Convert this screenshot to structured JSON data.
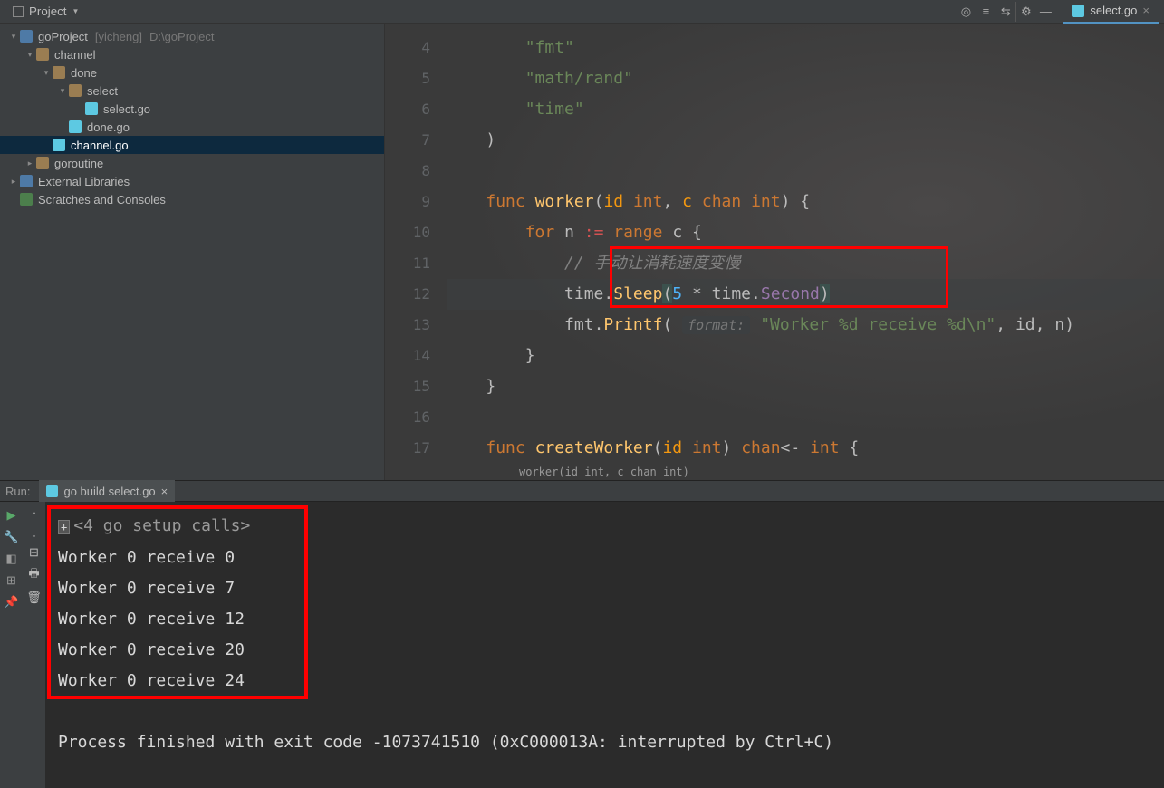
{
  "topbar": {
    "project_label": "Project",
    "toolbar_icons": [
      "target-icon",
      "collapse-icon",
      "settings-icon",
      "gear-icon",
      "minimize-icon"
    ]
  },
  "open_tab": {
    "name": "select.go"
  },
  "tree": [
    {
      "depth": 0,
      "arrow": "down",
      "icon": "module",
      "label": "goProject",
      "hint": "[yicheng]",
      "extra": "D:\\goProject",
      "interact": true
    },
    {
      "depth": 1,
      "arrow": "down",
      "icon": "folder",
      "label": "channel",
      "interact": true
    },
    {
      "depth": 2,
      "arrow": "down",
      "icon": "folder",
      "label": "done",
      "interact": true
    },
    {
      "depth": 3,
      "arrow": "down",
      "icon": "folder",
      "label": "select",
      "interact": true
    },
    {
      "depth": 4,
      "arrow": "none",
      "icon": "go",
      "label": "select.go",
      "interact": true
    },
    {
      "depth": 3,
      "arrow": "none",
      "icon": "go",
      "label": "done.go",
      "interact": true
    },
    {
      "depth": 2,
      "arrow": "none",
      "icon": "go",
      "label": "channel.go",
      "interact": true,
      "selected": true
    },
    {
      "depth": 1,
      "arrow": "right",
      "icon": "folder",
      "label": "goroutine",
      "interact": true
    },
    {
      "depth": 0,
      "arrow": "right",
      "icon": "module",
      "label": "External Libraries",
      "interact": true
    },
    {
      "depth": 0,
      "arrow": "none",
      "icon": "scratch",
      "label": "Scratches and Consoles",
      "interact": true
    }
  ],
  "editor": {
    "lines": [
      4,
      5,
      6,
      7,
      8,
      9,
      10,
      11,
      12,
      13,
      14,
      15,
      16,
      17
    ],
    "code": {
      "l4": "\"fmt\"",
      "l5": "\"math/rand\"",
      "l6": "\"time\"",
      "l9_func": "func",
      "l9_name": "worker",
      "l9_p1": "id",
      "l9_t1": "int",
      "l9_p2": "c",
      "l9_kw": "chan",
      "l9_t2": "int",
      "l10_for": "for",
      "l10_n": "n",
      "l10_assign": ":=",
      "l10_range": "range",
      "l10_c": "c",
      "l11_comment": "// 手动让消耗速度变慢",
      "l12_time": "time",
      "l12_sleep": "Sleep",
      "l12_5": "5",
      "l12_star": "*",
      "l12_time2": "time",
      "l12_sec": "Second",
      "l13_fmt": "fmt",
      "l13_printf": "Printf",
      "l13_hint": "format:",
      "l13_fmtstr": "\"Worker %d receive %d\\n\"",
      "l13_id": "id",
      "l13_n": "n",
      "l17_func": "func",
      "l17_name": "createWorker",
      "l17_p": "id",
      "l17_t": "int",
      "l17_chan": "chan",
      "l17_arr": "<-",
      "l17_int": "int"
    },
    "breadcrumb": "worker(id int, c chan int)"
  },
  "run": {
    "panel_label": "Run:",
    "tab": "go build select.go",
    "fold_label": "<4 go setup calls>",
    "output": [
      "Worker 0 receive 0",
      "Worker 0 receive 7",
      "Worker 0 receive 12",
      "Worker 0 receive 20",
      "Worker 0 receive 24"
    ],
    "exit": "Process finished with exit code -1073741510 (0xC000013A: interrupted by Ctrl+C)"
  }
}
